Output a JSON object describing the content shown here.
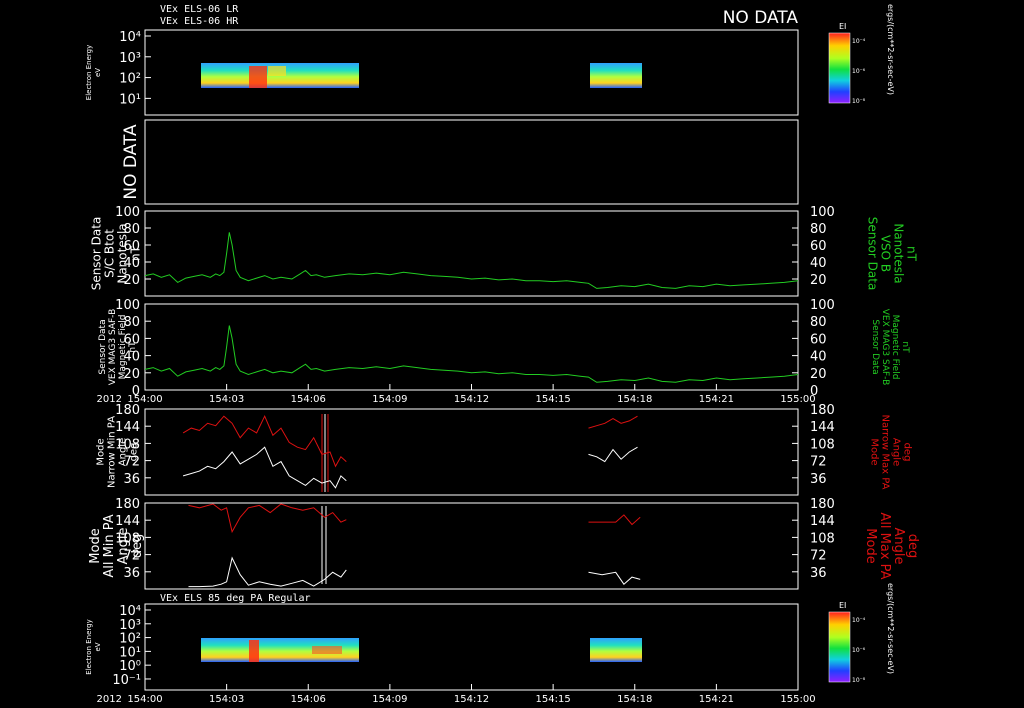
{
  "header": {
    "title_lr": "VEx ELS-06 LR",
    "title_hr": "VEx ELS-06 HR",
    "no_data": "NO DATA"
  },
  "colors": {
    "background": "#000000",
    "frame": "#ffffff",
    "mag_trace": "#22cc22",
    "max_pa": "#dd1111",
    "min_pa": "#ffffff"
  },
  "time_axis": {
    "tick_labels": [
      "154:00",
      "154:03",
      "154:06",
      "154:09",
      "154:12",
      "154:15",
      "154:18",
      "154:21",
      "155:00"
    ],
    "year_label": "2012"
  },
  "colorbar": {
    "label": "EI",
    "ticks": [
      "10⁻⁴",
      "10⁻⁶",
      "10⁻⁸"
    ],
    "unit_label": "ergs/(cm**2-sr-sec-eV)"
  },
  "chart_data": [
    {
      "type": "heatmap",
      "panel": "els-lr-hr-spectrogram",
      "ylabel": [
        "Electron Energy",
        "eV"
      ],
      "yticks": [
        "10⁴",
        "10³",
        "10²",
        "10¹"
      ],
      "scale": "log",
      "data_windows": [
        [
          "154:01.5",
          "154:07.4"
        ],
        [
          "154:16.3",
          "154:18.2"
        ]
      ]
    },
    {
      "type": "line",
      "panel": "empty-no-data",
      "left_label": "NO DATA"
    },
    {
      "type": "line",
      "panel": "btot",
      "left_label": [
        "Sensor Data",
        "S/C Btot",
        "Nanotesla",
        "nT"
      ],
      "right_label": [
        "Sensor Data",
        "VSO B",
        "Nanotesla",
        "nT"
      ],
      "ylim": [
        0,
        100
      ],
      "yticks": [
        "100",
        "80",
        "60",
        "40",
        "20"
      ],
      "series": [
        {
          "x": [
            0,
            0.3,
            0.6,
            0.9,
            1.2,
            1.5,
            1.8,
            2.1,
            2.4,
            2.6,
            2.75,
            2.9,
            3.0,
            3.1,
            3.2,
            3.35,
            3.5,
            3.8,
            4.1,
            4.4,
            4.7,
            5.0,
            5.4,
            5.7,
            5.9,
            6.1,
            6.3,
            6.6,
            7.0,
            7.5,
            8.0,
            8.5,
            9.0,
            9.5,
            10.0,
            10.5,
            11.0,
            11.5,
            12.0,
            12.5,
            13.0,
            13.5,
            14.0,
            14.5,
            15.0,
            15.5,
            16.0,
            16.3,
            16.6,
            17.0,
            17.5,
            18.0,
            18.5,
            19.0,
            19.5,
            20.0,
            20.5,
            21.0,
            21.5,
            22.0,
            22.5,
            23.0,
            23.5,
            24.0
          ],
          "y": [
            24,
            26,
            22,
            25,
            16,
            21,
            23,
            25,
            22,
            26,
            24,
            28,
            50,
            75,
            60,
            30,
            22,
            18,
            21,
            24,
            20,
            22,
            20,
            26,
            30,
            24,
            25,
            22,
            24,
            26,
            25,
            27,
            25,
            28,
            26,
            24,
            23,
            22,
            20,
            21,
            19,
            20,
            18,
            18,
            17,
            18,
            16,
            15,
            9,
            10,
            12,
            11,
            14,
            10,
            9,
            12,
            11,
            14,
            12,
            13,
            14,
            15,
            16,
            18
          ]
        }
      ]
    },
    {
      "type": "line",
      "panel": "mag-saf-b",
      "left_label": [
        "Sensor Data",
        "VEX MAG3 SAF-B",
        "Magnetic Field",
        "nT"
      ],
      "right_label": [
        "Sensor Data",
        "VEX MAG3 SAF-B",
        "Magnetic Field",
        "nT"
      ],
      "ylim": [
        0,
        100
      ],
      "yticks": [
        "100",
        "80",
        "60",
        "40",
        "20",
        "0"
      ],
      "series": [
        {
          "x": [
            0,
            0.3,
            0.6,
            0.9,
            1.2,
            1.5,
            1.8,
            2.1,
            2.4,
            2.6,
            2.75,
            2.9,
            3.0,
            3.1,
            3.2,
            3.35,
            3.5,
            3.8,
            4.1,
            4.4,
            4.7,
            5.0,
            5.4,
            5.7,
            5.9,
            6.1,
            6.3,
            6.6,
            7.0,
            7.5,
            8.0,
            8.5,
            9.0,
            9.5,
            10.0,
            10.5,
            11.0,
            11.5,
            12.0,
            12.5,
            13.0,
            13.5,
            14.0,
            14.5,
            15.0,
            15.5,
            16.0,
            16.3,
            16.6,
            17.0,
            17.5,
            18.0,
            18.5,
            19.0,
            19.5,
            20.0,
            20.5,
            21.0,
            21.5,
            22.0,
            22.5,
            23.0,
            23.5,
            24.0
          ],
          "y": [
            24,
            26,
            22,
            25,
            16,
            21,
            23,
            25,
            22,
            26,
            24,
            28,
            50,
            75,
            60,
            30,
            22,
            18,
            21,
            24,
            20,
            22,
            20,
            26,
            30,
            24,
            25,
            22,
            24,
            26,
            25,
            27,
            25,
            28,
            26,
            24,
            23,
            22,
            20,
            21,
            19,
            20,
            18,
            18,
            17,
            18,
            16,
            15,
            9,
            10,
            12,
            11,
            14,
            10,
            9,
            12,
            11,
            14,
            12,
            13,
            14,
            15,
            16,
            18
          ]
        }
      ]
    },
    {
      "type": "line",
      "panel": "narrow-pa",
      "left_label": [
        "Mode",
        "Narrow Min PA",
        "Angle",
        "deg"
      ],
      "right_label": [
        "Mode",
        "Narrow Max PA",
        "Angle",
        "deg"
      ],
      "ylim": [
        0,
        180
      ],
      "yticks": [
        "180",
        "144",
        "108",
        "72",
        "36"
      ],
      "series": [
        {
          "name": "Max PA",
          "x": [
            1.4,
            1.7,
            2.0,
            2.3,
            2.6,
            2.9,
            3.2,
            3.5,
            3.8,
            4.1,
            4.4,
            4.7,
            5.0,
            5.3,
            5.6,
            5.9,
            6.2,
            6.5,
            6.8,
            7.0,
            7.2,
            7.4
          ],
          "y": [
            130,
            140,
            135,
            150,
            145,
            165,
            150,
            120,
            140,
            130,
            165,
            125,
            140,
            110,
            100,
            95,
            120,
            85,
            90,
            60,
            80,
            70
          ]
        },
        {
          "name": "Min PA",
          "x": [
            1.4,
            1.7,
            2.0,
            2.3,
            2.6,
            2.9,
            3.2,
            3.5,
            3.8,
            4.1,
            4.4,
            4.7,
            5.0,
            5.3,
            5.6,
            5.9,
            6.2,
            6.5,
            6.8,
            7.0,
            7.2,
            7.4
          ],
          "y": [
            40,
            45,
            50,
            60,
            55,
            70,
            90,
            65,
            75,
            85,
            100,
            60,
            70,
            40,
            30,
            20,
            35,
            25,
            30,
            15,
            40,
            30
          ]
        },
        {
          "name": "Max PA",
          "x": [
            16.3,
            16.6,
            16.9,
            17.2,
            17.5,
            17.8,
            18.1
          ],
          "y": [
            140,
            145,
            150,
            160,
            150,
            155,
            165
          ]
        },
        {
          "name": "Min PA",
          "x": [
            16.3,
            16.6,
            16.9,
            17.2,
            17.5,
            17.8,
            18.1
          ],
          "y": [
            85,
            80,
            70,
            95,
            75,
            90,
            100
          ]
        }
      ]
    },
    {
      "type": "line",
      "panel": "all-pa",
      "left_label": [
        "Mode",
        "All Min PA",
        "Angle",
        "deg"
      ],
      "right_label": [
        "Mode",
        "All Max PA",
        "Angle",
        "deg"
      ],
      "ylim": [
        0,
        180
      ],
      "yticks": [
        "180",
        "144",
        "108",
        "72",
        "36"
      ],
      "series": [
        {
          "name": "Max PA",
          "x": [
            1.6,
            2.0,
            2.5,
            2.8,
            3.0,
            3.2,
            3.5,
            3.8,
            4.2,
            4.6,
            5.0,
            5.4,
            5.8,
            6.2,
            6.6,
            6.9,
            7.2,
            7.4
          ],
          "y": [
            175,
            170,
            178,
            165,
            170,
            120,
            150,
            170,
            175,
            160,
            178,
            170,
            165,
            170,
            150,
            160,
            140,
            145
          ]
        },
        {
          "name": "Min PA",
          "x": [
            1.6,
            2.0,
            2.5,
            2.8,
            3.0,
            3.2,
            3.5,
            3.8,
            4.2,
            4.6,
            5.0,
            5.4,
            5.8,
            6.2,
            6.6,
            6.9,
            7.2,
            7.4
          ],
          "y": [
            5,
            5,
            6,
            10,
            15,
            65,
            30,
            8,
            15,
            10,
            6,
            12,
            18,
            6,
            20,
            35,
            25,
            40
          ]
        },
        {
          "name": "Max PA",
          "x": [
            16.3,
            16.8,
            17.3,
            17.6,
            17.9,
            18.2
          ],
          "y": [
            140,
            140,
            140,
            155,
            135,
            150
          ]
        },
        {
          "name": "Min PA",
          "x": [
            16.3,
            16.8,
            17.3,
            17.6,
            17.9,
            18.2
          ],
          "y": [
            35,
            30,
            35,
            10,
            25,
            20
          ]
        }
      ]
    },
    {
      "type": "heatmap",
      "panel": "els-85deg-spectrogram",
      "title": "VEx ELS 85 deg PA Regular",
      "ylabel": [
        "Electron Energy",
        "eV"
      ],
      "yticks": [
        "10⁴",
        "10³",
        "10²",
        "10¹",
        "10⁰",
        "10⁻¹"
      ],
      "scale": "log",
      "data_windows": [
        [
          "154:01.5",
          "154:07.4"
        ],
        [
          "154:16.3",
          "154:18.2"
        ]
      ]
    }
  ]
}
